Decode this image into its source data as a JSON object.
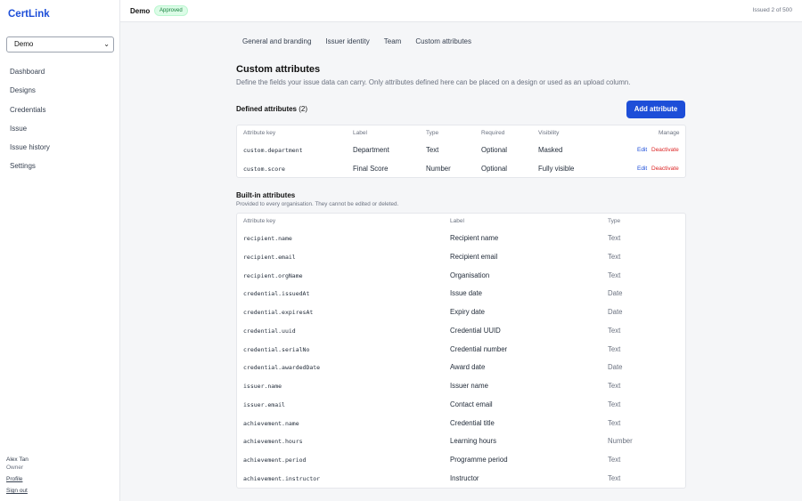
{
  "app": {
    "brand": "CertLink"
  },
  "org_select": {
    "value": "Demo"
  },
  "nav": [
    {
      "label": "Dashboard"
    },
    {
      "label": "Designs"
    },
    {
      "label": "Credentials"
    },
    {
      "label": "Issue"
    },
    {
      "label": "Issue history"
    },
    {
      "label": "Settings"
    }
  ],
  "user": {
    "name": "Alex Tan",
    "role": "Owner",
    "profile": "Profile",
    "signout": "Sign out"
  },
  "topbar": {
    "workspace": "Demo",
    "status": "Approved",
    "issued": "Issued 2 of 500"
  },
  "tabs": [
    {
      "label": "General and branding"
    },
    {
      "label": "Issuer identity"
    },
    {
      "label": "Team"
    },
    {
      "label": "Custom attributes"
    }
  ],
  "page": {
    "title": "Custom attributes",
    "description": "Define the fields your issue data can carry. Only attributes defined here can be placed on a design or used as an upload column."
  },
  "defined": {
    "heading": "Defined attributes",
    "count": "(2)",
    "add_button": "Add attribute",
    "columns": [
      "Attribute key",
      "Label",
      "Type",
      "Required",
      "Visibility",
      "Manage"
    ],
    "edit_label": "Edit",
    "deactivate_label": "Deactivate",
    "rows": [
      {
        "key": "custom.department",
        "label": "Department",
        "type": "Text",
        "required": "Optional",
        "visibility": "Masked"
      },
      {
        "key": "custom.score",
        "label": "Final Score",
        "type": "Number",
        "required": "Optional",
        "visibility": "Fully visible"
      }
    ]
  },
  "builtin": {
    "heading": "Built-in attributes",
    "description": "Provided to every organisation. They cannot be edited or deleted.",
    "columns": [
      "Attribute key",
      "Label",
      "Type"
    ],
    "rows": [
      {
        "key": "recipient.name",
        "label": "Recipient name",
        "type": "Text"
      },
      {
        "key": "recipient.email",
        "label": "Recipient email",
        "type": "Text"
      },
      {
        "key": "recipient.orgName",
        "label": "Organisation",
        "type": "Text"
      },
      {
        "key": "credential.issuedAt",
        "label": "Issue date",
        "type": "Date"
      },
      {
        "key": "credential.expiresAt",
        "label": "Expiry date",
        "type": "Date"
      },
      {
        "key": "credential.uuid",
        "label": "Credential UUID",
        "type": "Text"
      },
      {
        "key": "credential.serialNo",
        "label": "Credential number",
        "type": "Text"
      },
      {
        "key": "credential.awardedDate",
        "label": "Award date",
        "type": "Date"
      },
      {
        "key": "issuer.name",
        "label": "Issuer name",
        "type": "Text"
      },
      {
        "key": "issuer.email",
        "label": "Contact email",
        "type": "Text"
      },
      {
        "key": "achievement.name",
        "label": "Credential title",
        "type": "Text"
      },
      {
        "key": "achievement.hours",
        "label": "Learning hours",
        "type": "Number"
      },
      {
        "key": "achievement.period",
        "label": "Programme period",
        "type": "Text"
      },
      {
        "key": "achievement.instructor",
        "label": "Instructor",
        "type": "Text"
      }
    ]
  }
}
